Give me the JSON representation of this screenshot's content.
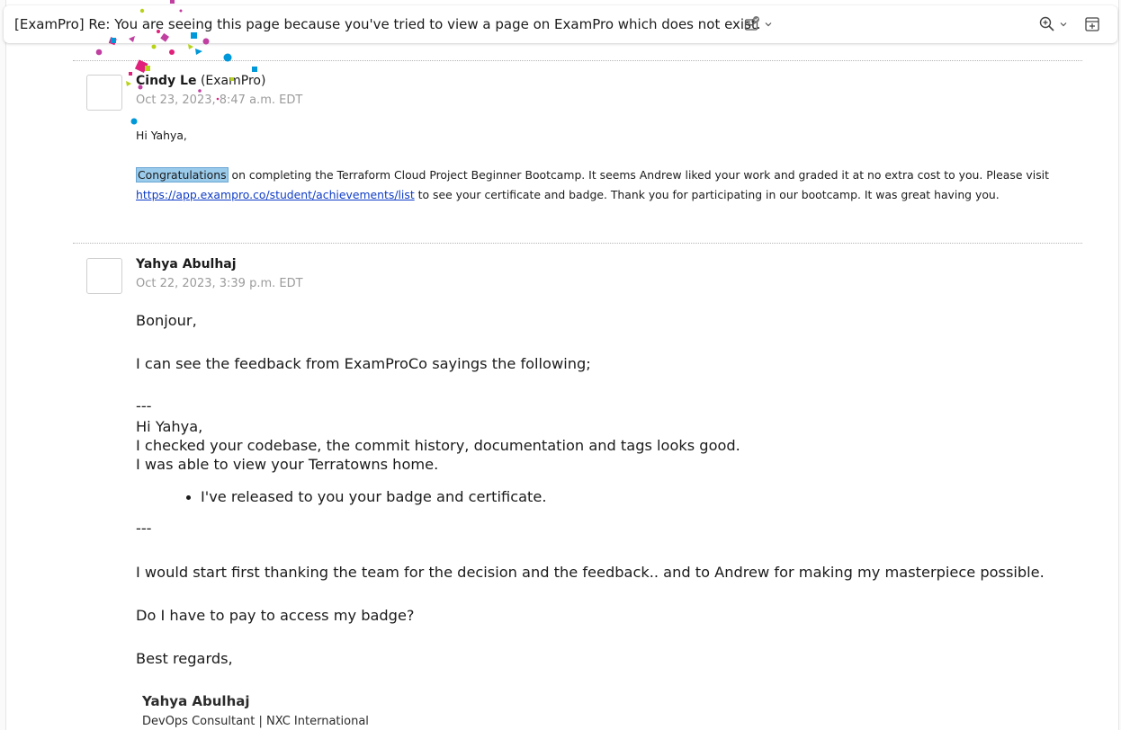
{
  "header": {
    "subject": "[ExamPro] Re: You are seeing this page because you've tried to view a page on ExamPro which does not exist.",
    "icons": {
      "summary": "envelope-check-icon",
      "zoom": "zoom-in-icon",
      "popout": "open-in-new-window-icon"
    }
  },
  "messages": [
    {
      "sender_name": "Cindy Le",
      "sender_org": "(ExamPro)",
      "date": "Oct 23, 2023, 8:47 a.m. EDT",
      "greeting": "Hi Yahya,",
      "highlight": "Congratulations",
      "line1_rest": " on completing the Terraform Cloud Project Beginner Bootcamp. It seems Andrew liked your work and graded it at no extra cost to you. Please visit",
      "link": "https://app.exampro.co/student/achievements/list",
      "line2_rest": " to see your certificate and badge. Thank you for participating in our bootcamp. It was great having you."
    },
    {
      "sender_name": "Yahya Abulhaj",
      "date": "Oct 22, 2023, 3:39 p.m. EDT",
      "body": {
        "p1": "Bonjour,",
        "p2": "I can see the feedback from ExamProCo sayings the following;",
        "dash1": "---",
        "q1": "Hi Yahya,",
        "q2": "I checked your codebase, the commit history, documentation and tags looks good.",
        "q3": "I was able to view your Terratowns home.",
        "bullet": "I've released to you your badge and certificate.",
        "dash2": "---",
        "p3": "I would start first thanking the team for the decision and the feedback.. and to Andrew for making my masterpiece possible.",
        "p4": "Do I have to pay to access my badge?",
        "p5": "Best regards,"
      },
      "signature": {
        "name": "Yahya Abulhaj",
        "title": "DevOps Consultant | NXC International"
      }
    }
  ],
  "colors": {
    "highlight": "#9bcbeb",
    "link": "#0f3cc6",
    "date": "#9b9b9b"
  }
}
